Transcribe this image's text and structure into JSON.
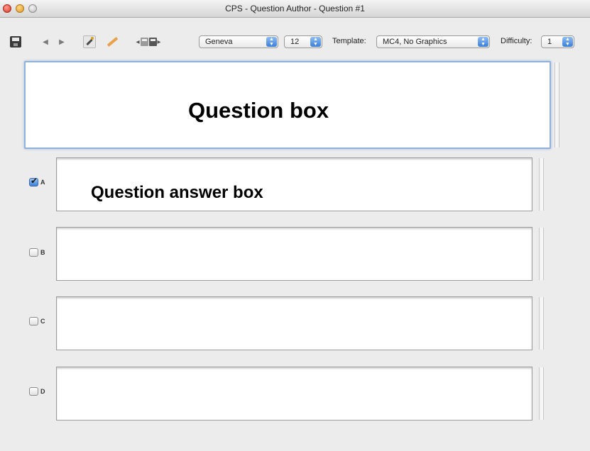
{
  "window": {
    "title": "CPS - Question Author - Question #1"
  },
  "toolbar": {
    "font_select": "Geneva",
    "size_select": "12",
    "template_label": "Template:",
    "template_select": "MC4, No Graphics",
    "difficulty_label": "Difficulty:",
    "difficulty_select": "1"
  },
  "question": {
    "box_label": "Question box"
  },
  "answers": {
    "box_label": "Question answer box",
    "items": [
      {
        "letter": "A",
        "checked": true
      },
      {
        "letter": "B",
        "checked": false
      },
      {
        "letter": "C",
        "checked": false
      },
      {
        "letter": "D",
        "checked": false
      }
    ]
  },
  "icons": [
    "save-icon",
    "back-arrow-icon",
    "forward-arrow-icon",
    "magic-wand-icon",
    "pencil-icon",
    "save-prev-next-icon"
  ]
}
